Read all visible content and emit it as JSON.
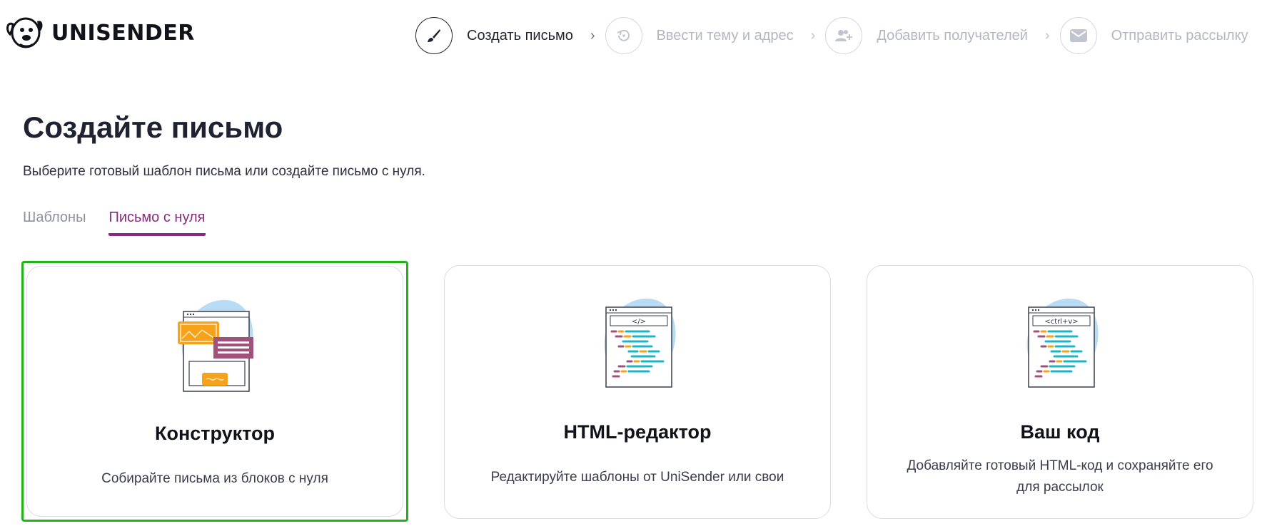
{
  "brand": {
    "name": "UNISENDER",
    "logo_icon": "dog-mascot-icon"
  },
  "steps": [
    {
      "label": "Создать письмо",
      "icon": "brush-icon",
      "active": true
    },
    {
      "label": "Ввести тему и адрес",
      "icon": "history-icon",
      "active": false
    },
    {
      "label": "Добавить получателей",
      "icon": "add-users-icon",
      "active": false
    },
    {
      "label": "Отправить рассылку",
      "icon": "envelope-icon",
      "active": false
    }
  ],
  "step_separator": "›",
  "main": {
    "title": "Создайте письмо",
    "subtitle": "Выберите готовый шаблон письма или создайте письмо с нуля."
  },
  "tabs": [
    {
      "label": "Шаблоны",
      "active": false
    },
    {
      "label": "Письмо с нуля",
      "active": true
    }
  ],
  "cards": [
    {
      "title": "Конструктор",
      "description": "Собирайте письма из блоков с нуля",
      "illustration": "constructor-illustration",
      "selected": true
    },
    {
      "title": "HTML-редактор",
      "description": "Редактируйте шаблоны от UniSender или свои",
      "illustration": "html-editor-illustration",
      "code_label": "</>",
      "selected": false
    },
    {
      "title": "Ваш код",
      "description": "Добавляйте готовый HTML-код и сохраняйте его для рассылок",
      "illustration": "your-code-illustration",
      "code_label": "<ctrl+v>",
      "selected": false
    }
  ],
  "colors": {
    "accent": "#8a2a7c",
    "selected_border": "#22b31a",
    "text_dark": "#1f2230",
    "text_muted": "#b4b6c3",
    "illustration_blue": "#b9dcf5",
    "illustration_orange": "#f7a21b",
    "illustration_plum": "#a0527a",
    "illustration_teal": "#1bb5c4"
  }
}
